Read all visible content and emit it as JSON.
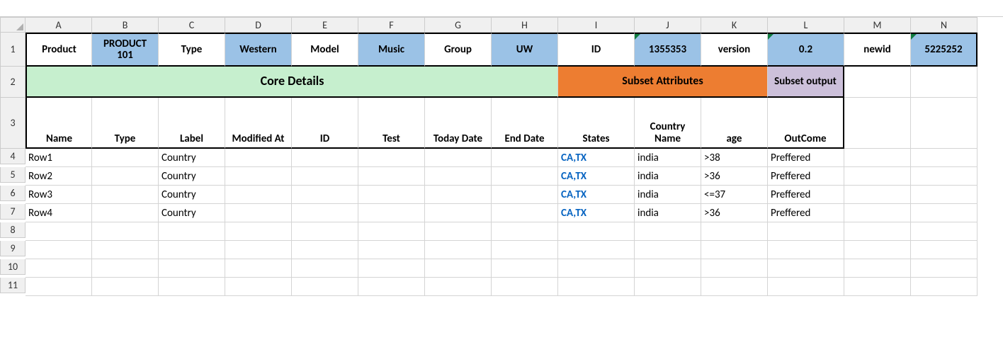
{
  "columns": [
    "A",
    "B",
    "C",
    "D",
    "E",
    "F",
    "G",
    "H",
    "I",
    "J",
    "K",
    "L",
    "M",
    "N"
  ],
  "row_numbers": [
    "1",
    "2",
    "3",
    "4",
    "5",
    "6",
    "7",
    "8",
    "9",
    "10",
    "11"
  ],
  "row1": {
    "A": "Product",
    "B": "PRODUCT 101",
    "C": "Type",
    "D": "Western",
    "E": "Model",
    "F": "Music",
    "G": "Group",
    "H": "UW",
    "I": "ID",
    "J": "1355353",
    "K": "version",
    "L": "0.2",
    "M": "newid",
    "N": "5225252"
  },
  "row2": {
    "core": "Core Details",
    "subset_attr": "Subset Attributes",
    "subset_out": "Subset output"
  },
  "row3": {
    "A": "Name",
    "B": "Type",
    "C": "Label",
    "D": "Modified At",
    "E": "ID",
    "F": "Test",
    "G": "Today Date",
    "H": "End Date",
    "I": "States",
    "J": "Country Name",
    "K": "age",
    "L": "OutCome"
  },
  "data_rows": [
    {
      "A": "Row1",
      "B": "",
      "C": "Country",
      "D": "",
      "E": "",
      "F": "",
      "G": "",
      "H": "",
      "I": "CA,TX",
      "J": "india",
      "K": ">38",
      "L": "Preffered"
    },
    {
      "A": "Row2",
      "B": "",
      "C": "Country",
      "D": "",
      "E": "",
      "F": "",
      "G": "",
      "H": "",
      "I": "CA,TX",
      "J": "india",
      "K": ">36",
      "L": "Preffered"
    },
    {
      "A": "Row3",
      "B": "",
      "C": "Country",
      "D": "",
      "E": "",
      "F": "",
      "G": "",
      "H": "",
      "I": "CA,TX",
      "J": "india",
      "K": "<=37",
      "L": "Preffered"
    },
    {
      "A": "Row4",
      "B": "",
      "C": "Country",
      "D": "",
      "E": "",
      "F": "",
      "G": "",
      "H": "",
      "I": "CA,TX",
      "J": "india",
      "K": ">36",
      "L": "Preffered"
    }
  ]
}
